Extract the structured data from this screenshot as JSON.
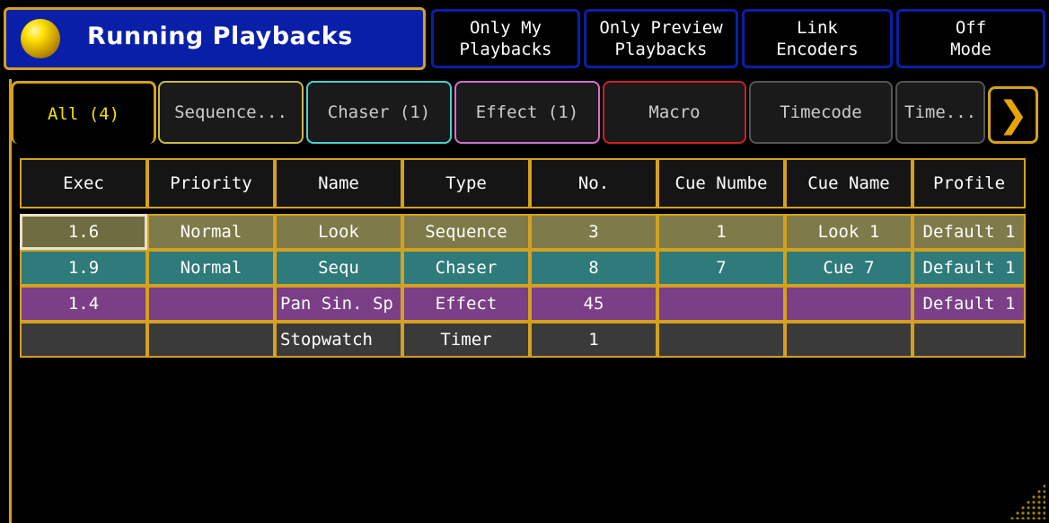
{
  "window": {
    "title": "Running Playbacks",
    "icon": "yellow-sphere-icon"
  },
  "toolbar": {
    "only_my": [
      "Only My",
      "Playbacks"
    ],
    "only_preview": [
      "Only Preview",
      "Playbacks"
    ],
    "link_encoders": [
      "Link",
      "Encoders"
    ],
    "off_mode": [
      "Off",
      "Mode"
    ]
  },
  "tabs": [
    {
      "label": "All (4)",
      "color": "#d4a11e",
      "active": true
    },
    {
      "label": "Sequence...",
      "color": "#c8b94a"
    },
    {
      "label": "Chaser (1)",
      "color": "#4ad0d0"
    },
    {
      "label": "Effect (1)",
      "color": "#d070d0"
    },
    {
      "label": "Macro",
      "color": "#cc2222"
    },
    {
      "label": "Timecode",
      "color": "#555555"
    },
    {
      "label": "Time...",
      "color": "#555555"
    }
  ],
  "table": {
    "columns": [
      "Exec",
      "Priority",
      "Name",
      "Type",
      "No.",
      "Cue Numbe",
      "Cue Name",
      "Profile"
    ],
    "rows": [
      {
        "exec": "1.6",
        "priority": "Normal",
        "name": "Look",
        "type": "Sequence",
        "no": "3",
        "cue_number": "1",
        "cue_name": "Look 1",
        "profile": "Default 1"
      },
      {
        "exec": "1.9",
        "priority": "Normal",
        "name": "Sequ",
        "type": "Chaser",
        "no": "8",
        "cue_number": "7",
        "cue_name": "Cue 7",
        "profile": "Default 1"
      },
      {
        "exec": "1.4",
        "priority": "",
        "name": "Pan Sin. Sp",
        "type": "Effect",
        "no": "45",
        "cue_number": "",
        "cue_name": "",
        "profile": "Default 1"
      },
      {
        "exec": "",
        "priority": "",
        "name": "Stopwatch",
        "type": "Timer",
        "no": "1",
        "cue_number": "",
        "cue_name": "",
        "profile": ""
      }
    ]
  },
  "colors": {
    "title_bg": "#0a1fa8",
    "frame": "#d4a11e",
    "sequence_row": "#7e7a4a",
    "chaser_row": "#2f7a7a",
    "effect_row": "#7a3f86",
    "timer_row": "#3a3a3a"
  }
}
